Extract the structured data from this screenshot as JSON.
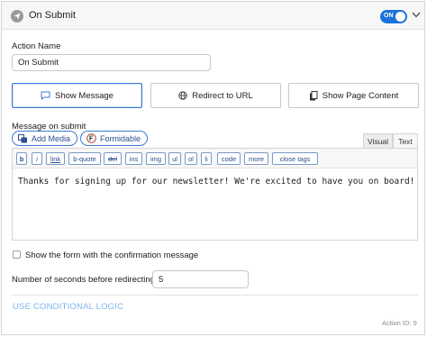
{
  "header": {
    "title": "On Submit",
    "toggle_label": "ON"
  },
  "action_name": {
    "label": "Action Name",
    "value": "On Submit"
  },
  "options": [
    {
      "label": "Show Message",
      "active": true
    },
    {
      "label": "Redirect to URL",
      "active": false
    },
    {
      "label": "Show Page Content",
      "active": false
    }
  ],
  "message": {
    "label": "Message on submit",
    "add_media_label": "Add Media",
    "formidable_label": "Formidable",
    "tab_visual": "Visual",
    "tab_text": "Text",
    "toolbar": [
      "b",
      "i",
      "link",
      "b-quote",
      "del",
      "ins",
      "img",
      "ul",
      "ol",
      "li",
      "code",
      "more",
      "close tags"
    ],
    "content": "Thanks for signing up for our newsletter! We're excited to have you on board!"
  },
  "show_form": {
    "label": "Show the form with the confirmation message",
    "checked": false
  },
  "redirect_seconds": {
    "label": "Number of seconds before redirecting",
    "value": "5"
  },
  "conditional_logic_label": "USE CONDITIONAL LOGIC",
  "action_id": "Action ID: 9",
  "colors": {
    "accent": "#1a73d9",
    "link": "#7fb3ec",
    "button_border": "#3a7bd5"
  }
}
